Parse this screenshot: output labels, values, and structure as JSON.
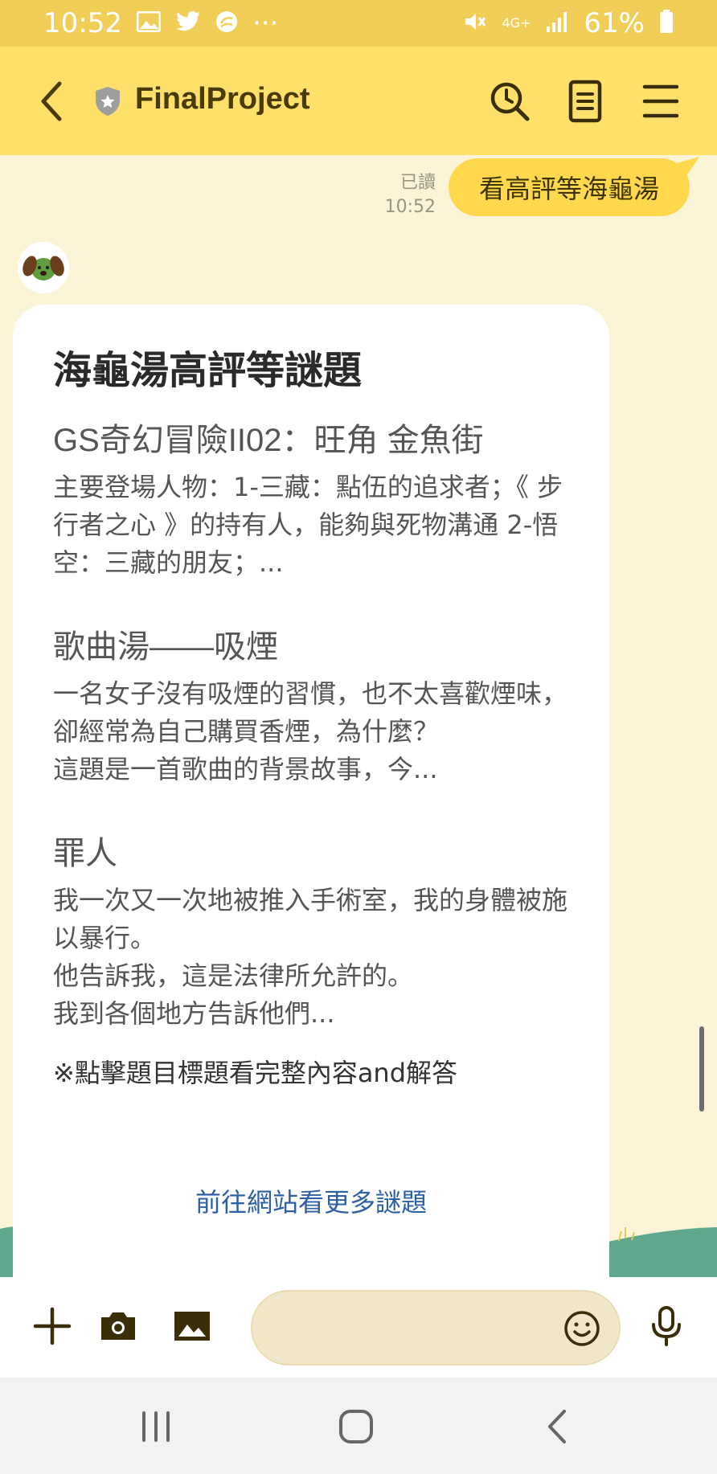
{
  "status_bar": {
    "time": "10:52",
    "more": "···",
    "network": "4G+",
    "battery": "61%",
    "icons": [
      "image-icon",
      "twitter-icon",
      "app-notify-icon",
      "mute-icon",
      "signal-icon",
      "battery-icon"
    ]
  },
  "app_bar": {
    "title": "FinalProject",
    "icons": [
      "back-icon",
      "shield-icon",
      "search-history-icon",
      "notes-icon",
      "menu-icon"
    ]
  },
  "chat": {
    "sent_message": {
      "text": "看高評等海龜湯",
      "read_label": "已讀",
      "time": "10:52"
    },
    "card": {
      "title": "海龜湯高評等謎題",
      "items": [
        {
          "title": "GS奇幻冒險II02：旺角 金魚街",
          "body": "主要登場人物：1-三藏：點伍的追求者；《 步行者之心 》的持有人，能夠與死物溝通 2-悟空：三藏的朋友；..."
        },
        {
          "title": "歌曲湯——吸煙",
          "body": "一名女子沒有吸煙的習慣，也不太喜歡煙味，卻經常為自己購買香煙，為什麼？\n這題是一首歌曲的背景故事，今..."
        },
        {
          "title": "罪人",
          "body": "我一次又一次地被推入手術室，我的身體被施以暴行。\n他告訴我，這是法律所允許的。\n我到各個地方告訴他們..."
        }
      ],
      "note": "※點擊題目標題看完整內容and解答",
      "more_link": "前往網站看更多謎題"
    }
  },
  "input_bar": {
    "placeholder": "",
    "icons": [
      "plus-icon",
      "camera-icon",
      "gallery-icon",
      "emoji-icon",
      "microphone-icon"
    ]
  },
  "nav_bar": {
    "icons": [
      "recent-apps-icon",
      "home-icon",
      "back-nav-icon"
    ]
  },
  "colors": {
    "status_bar": "#F1CE57",
    "app_bar": "#FFE06B",
    "chat_bg": "#FBF4D6",
    "my_bubble": "#FFD84E",
    "link": "#2D5FA5"
  }
}
